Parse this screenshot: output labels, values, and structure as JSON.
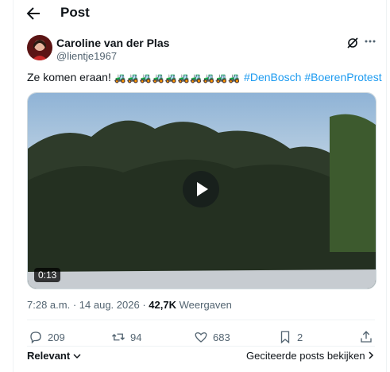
{
  "header": {
    "title": "Post",
    "back_icon": "arrow-left-icon"
  },
  "author": {
    "name": "Caroline van der Plas",
    "handle": "@lientje1967"
  },
  "tweet": {
    "text": "Ze komen eraan!",
    "emoji": "🚜🚜🚜🚜🚜🚜🚜🚜🚜🚜",
    "hashtags": [
      "#DenBosch",
      "#BoerenProtest"
    ]
  },
  "video": {
    "duration": "0:13"
  },
  "meta": {
    "time": "7:28 a.m.",
    "separator": "·",
    "date": "14 aug. 2026",
    "views_count": "42,7K",
    "views_label": "Weergaven"
  },
  "actions": {
    "replies": "209",
    "reposts": "94",
    "likes": "683",
    "bookmarks": "2"
  },
  "footer": {
    "sort_label": "Relevant",
    "quotes_link": "Geciteerde posts bekijken"
  }
}
